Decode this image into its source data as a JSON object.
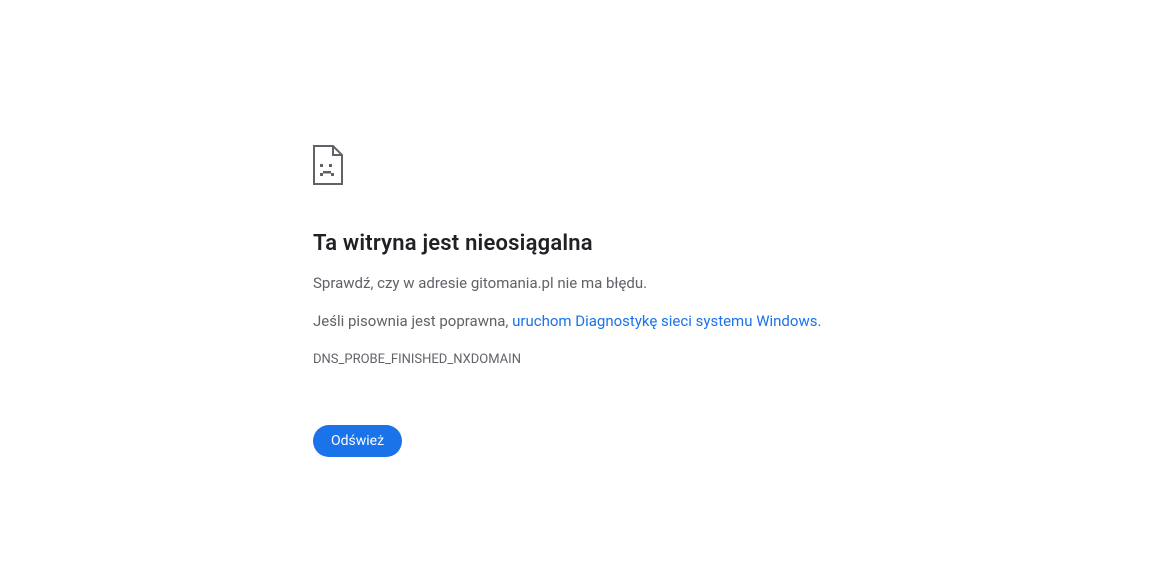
{
  "error": {
    "title": "Ta witryna jest nieosiągalna",
    "line1_pre": "Sprawdź, czy w adresie ",
    "line1_domain": "gitomania.pl",
    "line1_post": " nie ma błędu.",
    "line2_pre": "Jeśli pisownia jest poprawna, ",
    "line2_link": "uruchom Diagnostykę sieci systemu Windows",
    "line2_post": ".",
    "code": "DNS_PROBE_FINISHED_NXDOMAIN",
    "reload_label": "Odśwież"
  }
}
